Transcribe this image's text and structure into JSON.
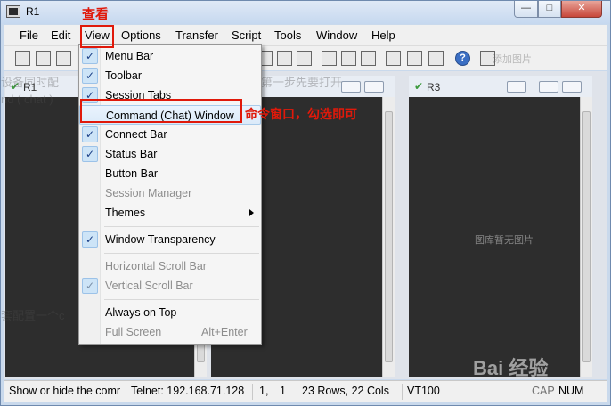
{
  "window": {
    "title": "R1"
  },
  "annotations": {
    "view_caption": "查看",
    "command_caption": "命令窗口，勾选即可"
  },
  "menubar": {
    "items": [
      "File",
      "Edit",
      "View",
      "Options",
      "Transfer",
      "Script",
      "Tools",
      "Window",
      "Help"
    ]
  },
  "panes": [
    {
      "label": "R1"
    },
    {
      "label": "R3"
    }
  ],
  "watermarks": {
    "line1": "设备同时配",
    "line1b": "第一步先要打开",
    "line2": "nd ( chat )",
    "line3": "套配置一个c",
    "add_image": "添加图片",
    "no_image": "图库暂无图片",
    "baidu": "Bai 经验"
  },
  "view_menu": {
    "items": [
      {
        "label": "Menu Bar",
        "checked": true,
        "enabled": true
      },
      {
        "label": "Toolbar",
        "checked": true,
        "enabled": true
      },
      {
        "label": "Session Tabs",
        "checked": true,
        "enabled": true
      },
      {
        "label": "Command (Chat) Window",
        "checked": false,
        "enabled": true,
        "highlighted": true
      },
      {
        "label": "Connect Bar",
        "checked": true,
        "enabled": true
      },
      {
        "label": "Status Bar",
        "checked": true,
        "enabled": true
      },
      {
        "label": "Button Bar",
        "checked": false,
        "enabled": true
      },
      {
        "label": "Session Manager",
        "checked": false,
        "enabled": false
      },
      {
        "label": "Themes",
        "checked": false,
        "enabled": true,
        "submenu": true
      },
      {
        "label": "Window Transparency",
        "checked": true,
        "enabled": true
      },
      {
        "label": "Horizontal Scroll Bar",
        "checked": false,
        "enabled": false
      },
      {
        "label": "Vertical Scroll Bar",
        "checked": true,
        "enabled": false
      },
      {
        "label": "Always on Top",
        "checked": false,
        "enabled": true
      },
      {
        "label": "Full Screen",
        "checked": false,
        "enabled": false,
        "shortcut": "Alt+Enter"
      }
    ]
  },
  "statusbar": {
    "hint": "Show or hide the comr",
    "connection": "Telnet: 192.168.71.128",
    "cursor_row": "1,",
    "cursor_col": "1",
    "size": "23 Rows, 22 Cols",
    "terminal": "VT100",
    "caps": "CAP",
    "num": "NUM"
  }
}
